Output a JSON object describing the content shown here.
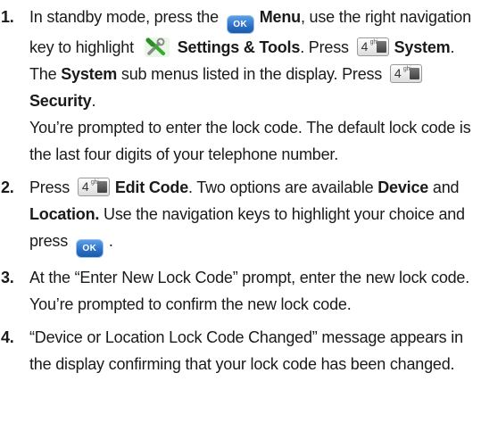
{
  "steps": [
    {
      "number": "1.",
      "parts": {
        "p1": "In standby mode, press the",
        "ok_label": "OK",
        "menu": "Menu",
        "p2": ", use the right navigation key to highlight",
        "settings": "Settings & Tools",
        "p3": ". Press",
        "key4_digit": "4",
        "key4_sub": "ghi",
        "system": "System",
        "p4": ". The",
        "system2": "System",
        "p5": "sub menus listed in the display. Press",
        "security": "Security",
        "p6": ".",
        "p7": "You’re prompted to enter the lock code. The default lock code is the last four digits of your telephone number."
      }
    },
    {
      "number": "2.",
      "parts": {
        "p1": "Press",
        "key4_digit": "4",
        "key4_sub": "ghi",
        "edit_code": "Edit Code",
        "p2": ". Two options are available",
        "device": "Device",
        "p3": "and",
        "location": "Location.",
        "p4": "Use the navigation keys to highlight your choice and press",
        "ok_label": "OK",
        "p5": "."
      }
    },
    {
      "number": "3.",
      "text": "At the “Enter New Lock Code” prompt, enter the new lock code. You’re prompted to confirm the new lock code."
    },
    {
      "number": "4.",
      "text": "“Device or Location Lock Code Changed” message appears in the display confirming that your lock code has been changed."
    }
  ],
  "colors": {
    "ok_key": "#2a6fc4",
    "tools_green": "#3aa832",
    "tools_gray": "#8a8a8a"
  },
  "icons": {
    "ok": "ok-key-icon",
    "num4": "number-4-key-icon",
    "settings": "settings-tools-icon"
  }
}
